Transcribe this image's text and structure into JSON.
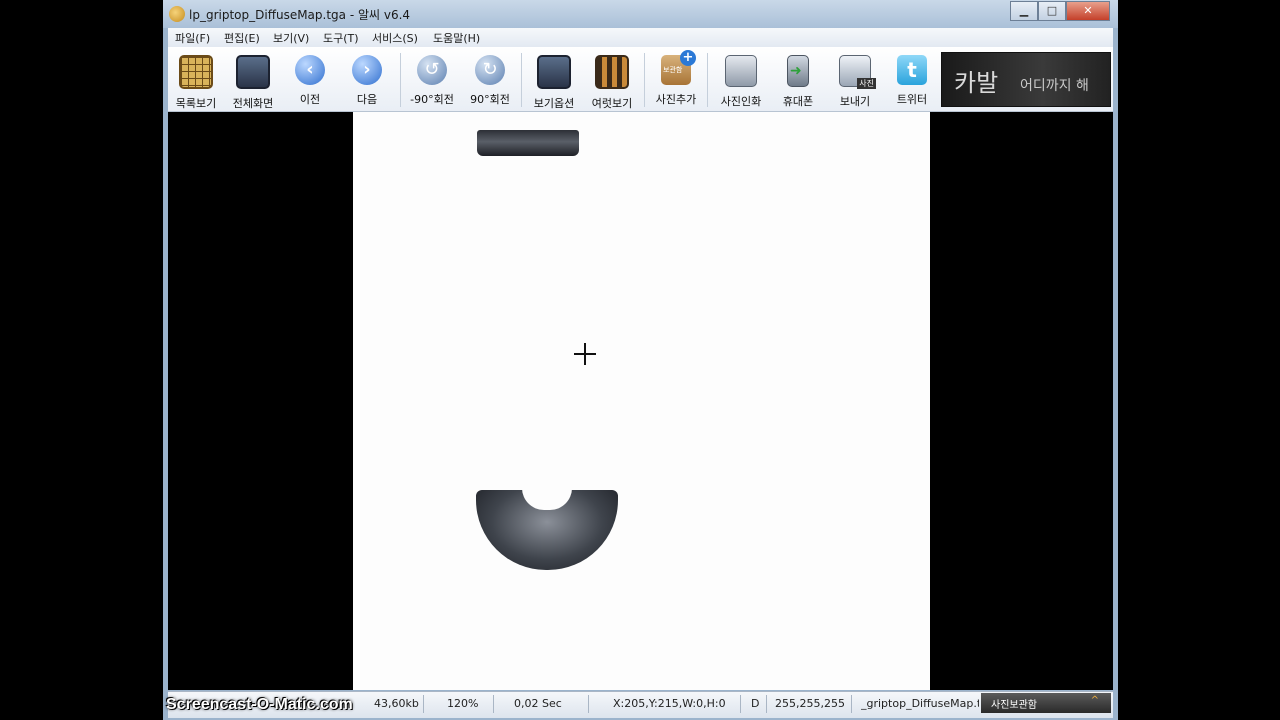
{
  "window": {
    "title": "lp_griptop_DiffuseMap.tga - 알씨 v6.4"
  },
  "window_controls": {
    "minimize": "▁",
    "maximize": "□",
    "close": "✕"
  },
  "menu": [
    "파일(F)",
    "편집(E)",
    "보기(V)",
    "도구(T)",
    "서비스(S)",
    "도움말(H)"
  ],
  "toolbar": {
    "list_view": "목록보기",
    "fullscreen": "전체화면",
    "prev": "이전",
    "next": "다음",
    "rotate_ccw": "-90°회전",
    "rotate_cw": "90°회전",
    "view_options": "보기옵션",
    "slideshow": "여럿보기",
    "add_photo": "사진추가",
    "print_photo": "사진인화",
    "phone": "휴대폰",
    "send": "보내기",
    "twitter": "트위터",
    "send_badge": "사진",
    "add_badge": "보관함"
  },
  "banner": {
    "title": "카발",
    "subtitle": "어디까지 해"
  },
  "status": {
    "file_size": "43,60kb",
    "zoom": "120%",
    "load_time": "0,02 Sec",
    "cursor": "X:205,Y:215,W:0,H:0",
    "mode": "D",
    "color_value": "255,255,255",
    "filename": "_griptop_DiffuseMap.tg",
    "album_label": "사진보관함",
    "album_chevron": "^"
  },
  "watermark": "Screencast-O-Matic.com",
  "colors": {
    "title_bar": "#aac0d8",
    "canvas": "#fdfdfd",
    "viewer_bg": "#000000"
  }
}
